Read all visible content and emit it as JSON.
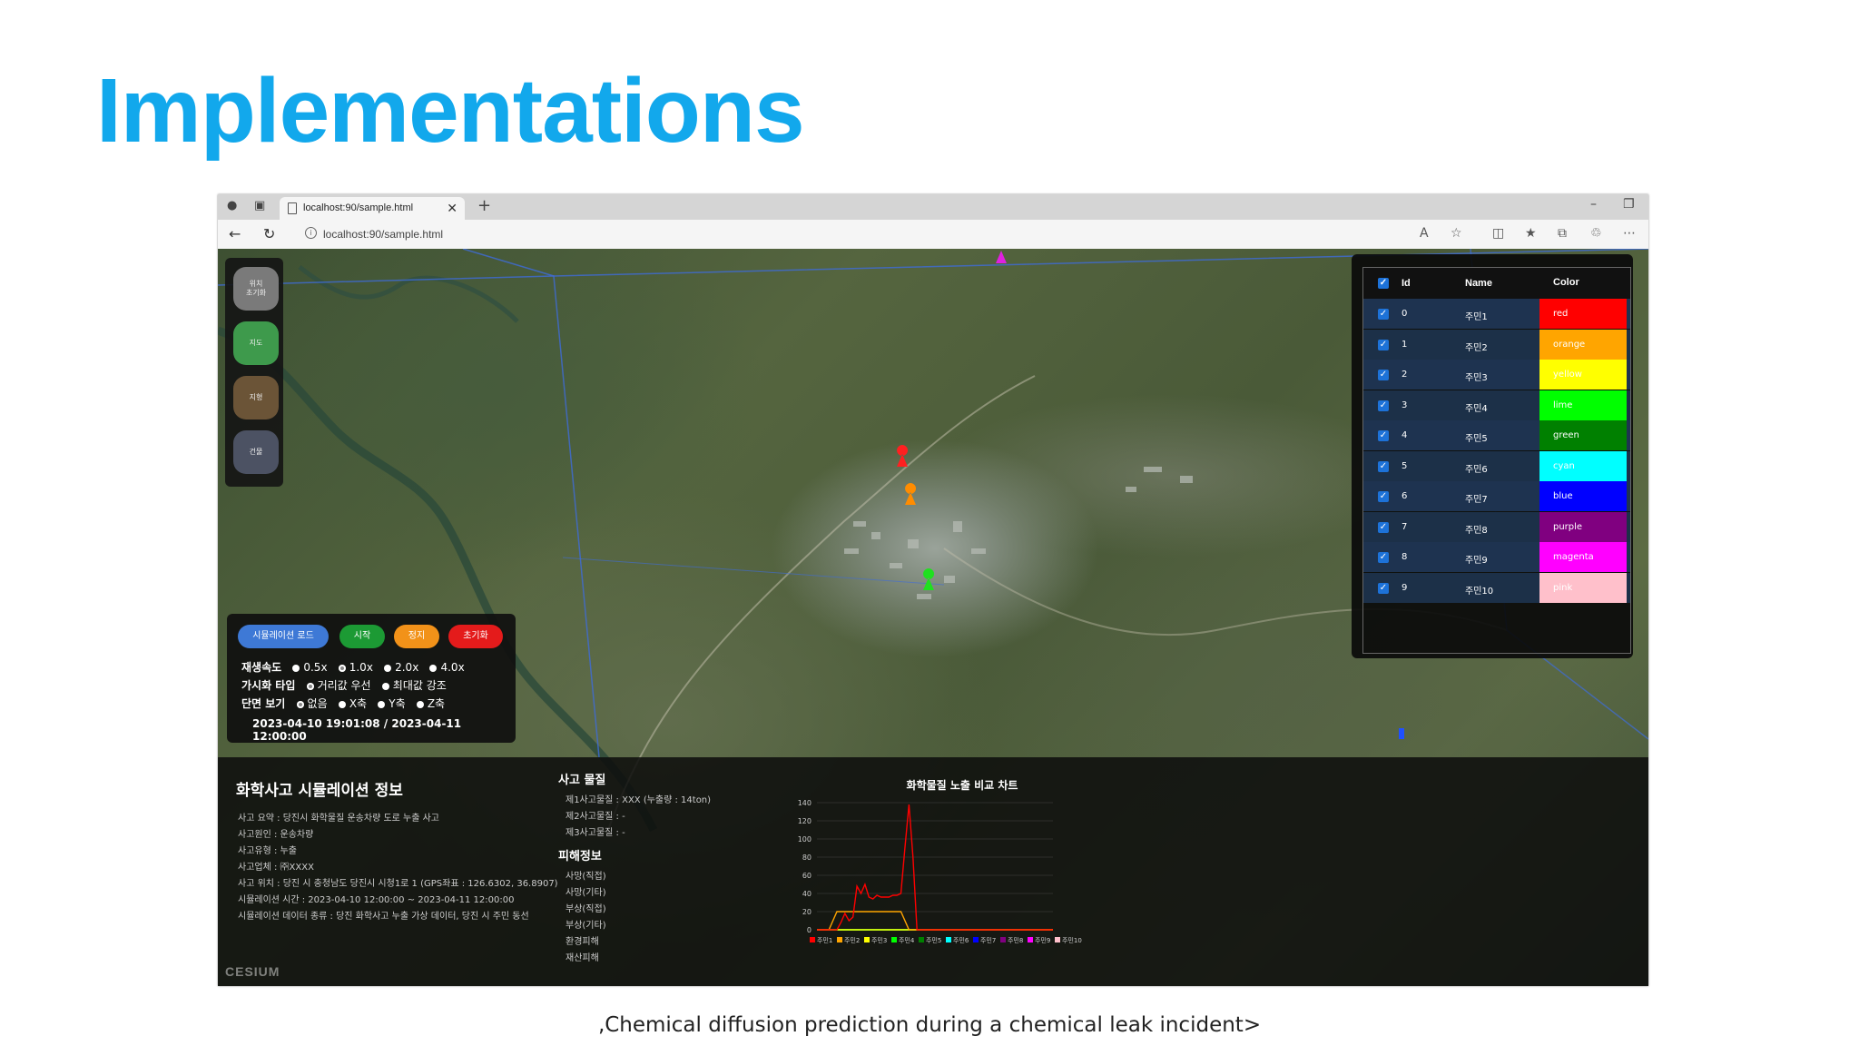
{
  "slide": {
    "title": "Implementations",
    "caption": "‚Chemical diffusion prediction during a chemical leak incident>"
  },
  "browser": {
    "tab_title": "localhost:90/sample.html",
    "url": "localhost:90/sample.html"
  },
  "left_panel": {
    "buttons": [
      {
        "label": "위치\n초기화",
        "color": "#7a7a7a"
      },
      {
        "label": "지도",
        "color": "#3e9a4c"
      },
      {
        "label": "지형",
        "color": "#6b5437"
      },
      {
        "label": "건물",
        "color": "#4c5263"
      }
    ]
  },
  "sim_panel": {
    "buttons": [
      {
        "label": "시뮬레이션 로드",
        "color": "#3e79d6"
      },
      {
        "label": "시작",
        "color": "#1c9a34"
      },
      {
        "label": "정지",
        "color": "#f29219"
      },
      {
        "label": "초기화",
        "color": "#e41b1b"
      }
    ],
    "speed": {
      "label": "재생속도",
      "options": [
        "0.5x",
        "1.0x",
        "2.0x",
        "4.0x"
      ],
      "selected": 1
    },
    "viz": {
      "label": "가시화 타입",
      "options": [
        "거리값 우선",
        "최대값 강조"
      ],
      "selected": 0
    },
    "section": {
      "label": "단면 보기",
      "options": [
        "없음",
        "X축",
        "Y축",
        "Z축"
      ],
      "selected": 0
    },
    "time": "2023-04-10 19:01:08 / 2023-04-11 12:00:00"
  },
  "table": {
    "headers": {
      "id": "Id",
      "name": "Name",
      "color": "Color"
    },
    "rows": [
      {
        "id": "0",
        "name": "주민1",
        "color": "red",
        "hex": "#ff0000"
      },
      {
        "id": "1",
        "name": "주민2",
        "color": "orange",
        "hex": "#ffa500"
      },
      {
        "id": "2",
        "name": "주민3",
        "color": "yellow",
        "hex": "#ffff00"
      },
      {
        "id": "3",
        "name": "주민4",
        "color": "lime",
        "hex": "#00ff00"
      },
      {
        "id": "4",
        "name": "주민5",
        "color": "green",
        "hex": "#008000"
      },
      {
        "id": "5",
        "name": "주민6",
        "color": "cyan",
        "hex": "#00ffff"
      },
      {
        "id": "6",
        "name": "주민7",
        "color": "blue",
        "hex": "#0000ff"
      },
      {
        "id": "7",
        "name": "주민8",
        "color": "purple",
        "hex": "#800080"
      },
      {
        "id": "8",
        "name": "주민9",
        "color": "magenta",
        "hex": "#ff00ff"
      },
      {
        "id": "9",
        "name": "주민10",
        "color": "pink",
        "hex": "#ffc0cb"
      }
    ]
  },
  "info": {
    "title": "화학사고 시뮬레이션 정보",
    "lines": [
      "사고 요약 : 당진시 화학물질 운송차량 도로 누출 사고",
      "사고원인 : 운송차량",
      "사고유형 : 누출",
      "사고업체 : ㈜XXXX",
      "사고 위치 : 당진 시 충청남도 당진시 시청1로 1 (GPS좌표 : 126.6302, 36.8907)",
      "시뮬레이션 시간 : 2023-04-10 12:00:00 ~ 2023-04-11 12:00:00",
      "시뮬레이션 데이터 종류 : 당진 화학사고 누출 가상 데이터, 당진 시 주민 동선"
    ],
    "substance_title": "사고 물질",
    "substances": [
      "제1사고물질 : XXX (누출량 : 14ton)",
      "제2사고물질 : -",
      "제3사고물질 : -"
    ],
    "damage_title": "피해정보",
    "damages": [
      "사망(직접)",
      "사망(기타)",
      "부상(직접)",
      "부상(기타)",
      "환경피해",
      "재산피해"
    ],
    "watermark": "CESIUM"
  },
  "chart_data": {
    "type": "line",
    "title": "화학물질 노출 비교 차트",
    "ylim": [
      0,
      140
    ],
    "yticks": [
      0,
      20,
      40,
      60,
      80,
      100,
      120,
      140
    ],
    "x_count": 60,
    "series": [
      {
        "name": "주민1",
        "color": "#ff0000",
        "points": [
          [
            0,
            0
          ],
          [
            5,
            0
          ],
          [
            6,
            8
          ],
          [
            7,
            18
          ],
          [
            8,
            10
          ],
          [
            9,
            14
          ],
          [
            10,
            48
          ],
          [
            11,
            40
          ],
          [
            12,
            50
          ],
          [
            13,
            36
          ],
          [
            14,
            34
          ],
          [
            15,
            38
          ],
          [
            16,
            36
          ],
          [
            17,
            36
          ],
          [
            18,
            36
          ],
          [
            19,
            38
          ],
          [
            20,
            38
          ],
          [
            21,
            40
          ],
          [
            22,
            90
          ],
          [
            23,
            138
          ],
          [
            24,
            80
          ],
          [
            25,
            0
          ],
          [
            59,
            0
          ]
        ]
      },
      {
        "name": "주민2",
        "color": "#ffa500",
        "points": [
          [
            0,
            0
          ],
          [
            3,
            0
          ],
          [
            5,
            20
          ],
          [
            20,
            20
          ],
          [
            21,
            20
          ],
          [
            23,
            0
          ],
          [
            59,
            0
          ]
        ]
      },
      {
        "name": "주민3",
        "color": "#ffff00",
        "points": [
          [
            0,
            0
          ],
          [
            59,
            0
          ]
        ]
      },
      {
        "name": "주민4",
        "color": "#00ff00",
        "points": [
          [
            0,
            0
          ],
          [
            59,
            0
          ]
        ]
      },
      {
        "name": "주민5",
        "color": "#008000",
        "points": [
          [
            0,
            0
          ],
          [
            59,
            0
          ]
        ]
      },
      {
        "name": "주민6",
        "color": "#00ffff",
        "points": [
          [
            0,
            0
          ],
          [
            59,
            0
          ]
        ]
      },
      {
        "name": "주민7",
        "color": "#0000ff",
        "points": [
          [
            0,
            0
          ],
          [
            59,
            0
          ]
        ]
      },
      {
        "name": "주민8",
        "color": "#800080",
        "points": [
          [
            0,
            0
          ],
          [
            59,
            0
          ]
        ]
      },
      {
        "name": "주민9",
        "color": "#ff00ff",
        "points": [
          [
            0,
            0
          ],
          [
            59,
            0
          ]
        ]
      },
      {
        "name": "주민10",
        "color": "#ffc0cb",
        "points": [
          [
            0,
            0
          ],
          [
            59,
            0
          ]
        ]
      }
    ]
  }
}
